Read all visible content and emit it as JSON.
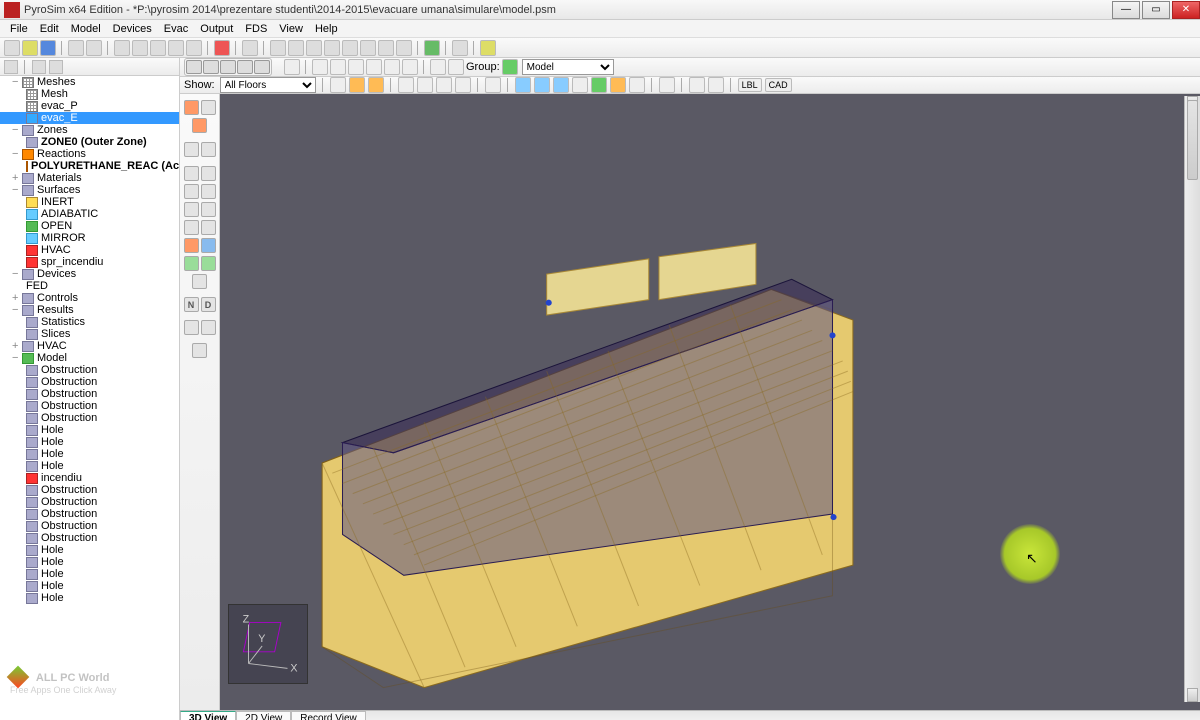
{
  "window": {
    "title": "PyroSim x64 Edition - *P:\\pyrosim 2014\\prezentare studenti\\2014-2015\\evacuare umana\\simulare\\model.psm"
  },
  "menu": [
    "File",
    "Edit",
    "Model",
    "Devices",
    "Evac",
    "Output",
    "FDS",
    "View",
    "Help"
  ],
  "group_label": "Group:",
  "group_value": "Model",
  "show_label": "Show:",
  "floors_value": "All Floors",
  "nd_buttons": [
    "N",
    "D"
  ],
  "caps": [
    "LBL",
    "CAD"
  ],
  "tree": {
    "meshes": {
      "label": "Meshes",
      "items": [
        "Mesh",
        "evac_P",
        "evac_E"
      ]
    },
    "zones": {
      "label": "Zones",
      "items": [
        "ZONE0 (Outer Zone)"
      ]
    },
    "reactions": {
      "label": "Reactions",
      "items": [
        "POLYURETHANE_REAC (Active)"
      ]
    },
    "materials": {
      "label": "Materials"
    },
    "surfaces": {
      "label": "Surfaces",
      "items": [
        "INERT",
        "ADIABATIC",
        "OPEN",
        "MIRROR",
        "HVAC",
        "spr_incendiu"
      ]
    },
    "devices": {
      "label": "Devices",
      "items": [
        "FED"
      ]
    },
    "controls": {
      "label": "Controls"
    },
    "results": {
      "label": "Results",
      "items": [
        "Statistics",
        "Slices"
      ]
    },
    "hvac": {
      "label": "HVAC"
    },
    "model": {
      "label": "Model",
      "items": [
        "Obstruction",
        "Obstruction",
        "Obstruction",
        "Obstruction",
        "Obstruction",
        "Hole",
        "Hole",
        "Hole",
        "Hole",
        "incendiu",
        "Obstruction",
        "Obstruction",
        "Obstruction",
        "Obstruction",
        "Obstruction",
        "Hole",
        "Hole",
        "Hole",
        "Hole",
        "Hole"
      ]
    }
  },
  "tabs": [
    "3D View",
    "2D View",
    "Record View"
  ],
  "compass_axes": [
    "X",
    "Y",
    "Z"
  ],
  "watermark": {
    "title": "ALL PC World",
    "sub": "Free Apps One Click Away"
  }
}
